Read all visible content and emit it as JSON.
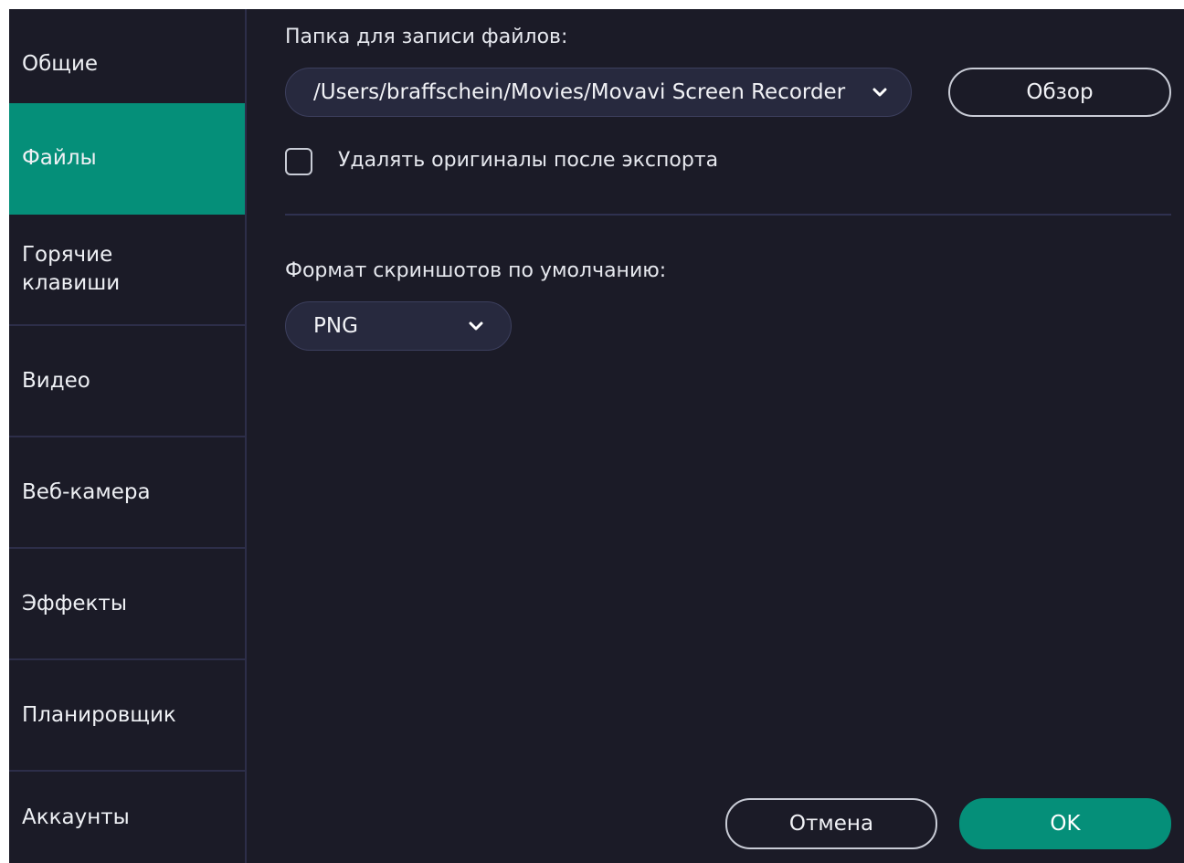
{
  "sidebar": {
    "items": [
      {
        "label": "Общие"
      },
      {
        "label": "Файлы"
      },
      {
        "label": "Горячие\nклавиши"
      },
      {
        "label": "Видео"
      },
      {
        "label": "Веб-камера"
      },
      {
        "label": "Эффекты"
      },
      {
        "label": "Планировщик"
      },
      {
        "label": "Аккаунты"
      }
    ],
    "active_item": "Файлы"
  },
  "files": {
    "folder_label": "Папка для записи файлов:",
    "folder_path": "/Users/braffschein/Movies/Movavi Screen Recorder",
    "browse_label": "Обзор",
    "delete_originals_label": "Удалять оригиналы после экспорта",
    "delete_originals_checked": false,
    "screenshot_format_label": "Формат скриншотов по умолчанию:",
    "screenshot_format_value": "PNG"
  },
  "footer": {
    "cancel_label": "Отмена",
    "ok_label": "OK"
  },
  "colors": {
    "background": "#1b1b27",
    "accent": "#058f79",
    "divider": "#2d2e49"
  },
  "icons": {
    "dropdown": "chevron-down-icon"
  }
}
